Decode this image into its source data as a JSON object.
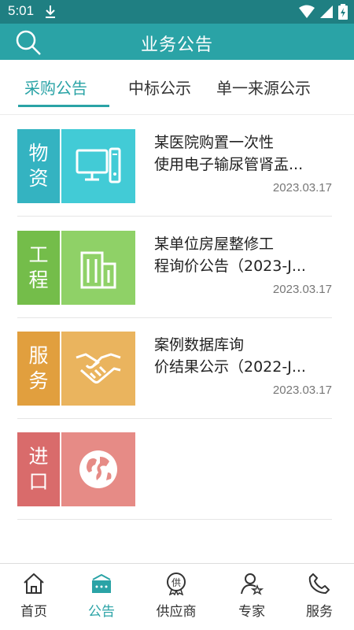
{
  "status_bar": {
    "time": "5:01"
  },
  "header": {
    "title": "业务公告"
  },
  "tabs": [
    {
      "label": "采购公告",
      "active": true
    },
    {
      "label": "中标公示",
      "active": false
    },
    {
      "label": "单一来源公示",
      "active": false
    }
  ],
  "items": [
    {
      "category_line1": "物",
      "category_line2": "资",
      "icon": "computer-icon",
      "badge_color": "#34b3c1",
      "icon_bg": "#42cbd6",
      "title_line1": "某医院购置一次性",
      "title_line2": "使用电子输尿管肾盂...",
      "date": "2023.03.17"
    },
    {
      "category_line1": "工",
      "category_line2": "程",
      "icon": "building-icon",
      "badge_color": "#74bd4a",
      "icon_bg": "#8fd167",
      "title_line1": "某单位房屋整修工",
      "title_line2": "程询价公告（2023-J...",
      "date": "2023.03.17"
    },
    {
      "category_line1": "服",
      "category_line2": "务",
      "icon": "handshake-icon",
      "badge_color": "#e19f3e",
      "icon_bg": "#eab45e",
      "title_line1": "案例数据库询",
      "title_line2": "价结果公示（2022-J...",
      "date": "2023.03.17"
    },
    {
      "category_line1": "进",
      "category_line2": "口",
      "icon": "globe-icon",
      "badge_color": "#d96b6b",
      "icon_bg": "#e68b86",
      "title_line1": "",
      "title_line2": "",
      "date": ""
    }
  ],
  "bottom_nav": [
    {
      "label": "首页",
      "icon": "home-icon",
      "active": false
    },
    {
      "label": "公告",
      "icon": "announcement-icon",
      "active": true
    },
    {
      "label": "供应商",
      "icon": "supplier-icon",
      "active": false
    },
    {
      "label": "专家",
      "icon": "expert-icon",
      "active": false
    },
    {
      "label": "服务",
      "icon": "phone-icon",
      "active": false
    }
  ],
  "colors": {
    "primary": "#2aa3a6",
    "status_bar": "#1f7f82"
  }
}
